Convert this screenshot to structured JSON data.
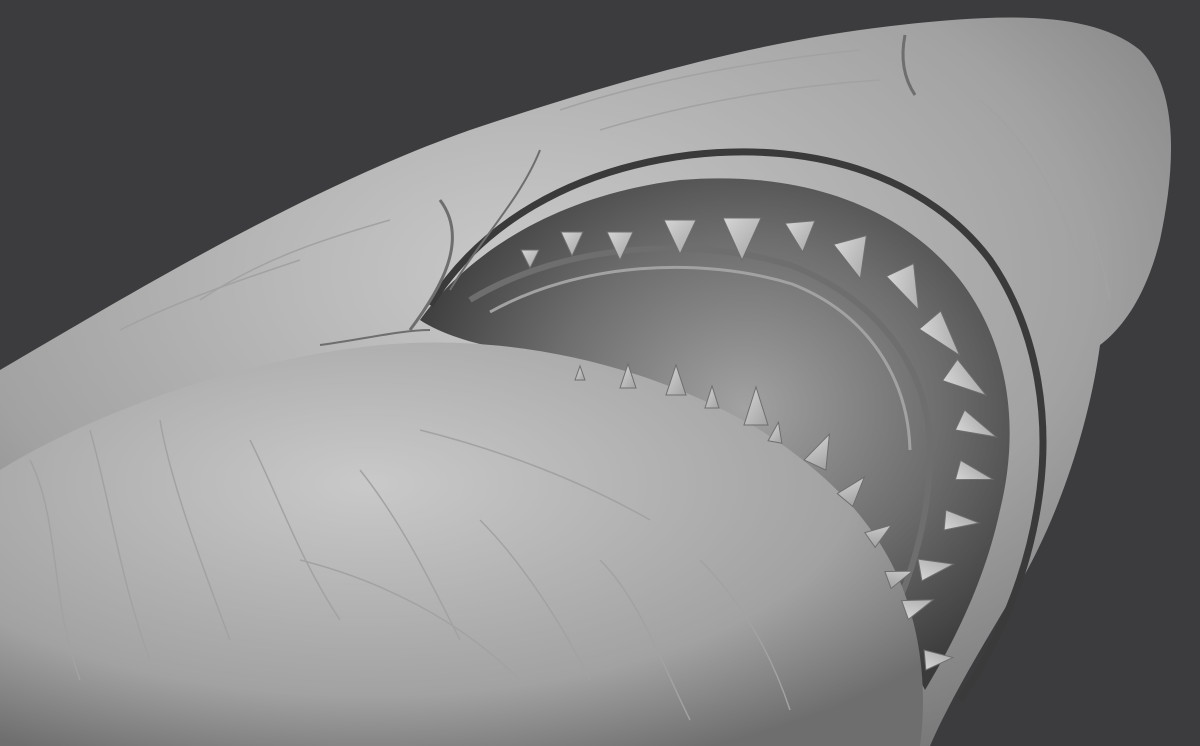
{
  "scene": {
    "subject": "shark-head-sculpt",
    "background_color": "#3c3c3e",
    "skin_light_color": "#c9c9c9",
    "skin_mid_color": "#a2a2a2",
    "skin_dark_color": "#6e6e6e",
    "mouth_dark_color": "#3a3a3a",
    "tooth_color": "#d6d6d6",
    "visible_text": []
  }
}
